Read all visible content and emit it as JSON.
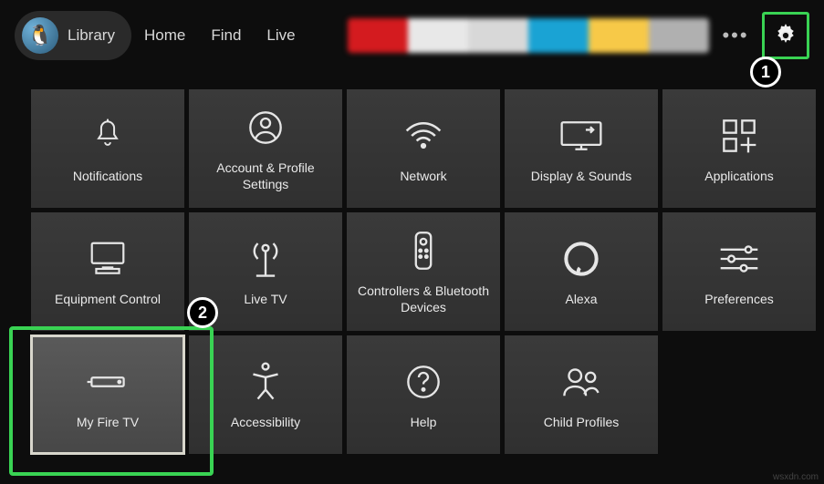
{
  "nav": {
    "library": "Library",
    "home": "Home",
    "find": "Find",
    "live": "Live"
  },
  "app_swatches": [
    "#d41b1f",
    "#e8e8e8",
    "#d8d8d8",
    "#1aa3d4",
    "#f7c948",
    "#b0b0b0"
  ],
  "tiles": {
    "notifications": "Notifications",
    "account": "Account & Profile Settings",
    "network": "Network",
    "display": "Display & Sounds",
    "applications": "Applications",
    "equipment": "Equipment Control",
    "livetv": "Live TV",
    "controllers": "Controllers & Bluetooth Devices",
    "alexa": "Alexa",
    "preferences": "Preferences",
    "myfiretv": "My Fire TV",
    "accessibility": "Accessibility",
    "help": "Help",
    "child": "Child Profiles"
  },
  "annotations": {
    "step1": "1",
    "step2": "2"
  },
  "watermark": "wsxdn.com"
}
